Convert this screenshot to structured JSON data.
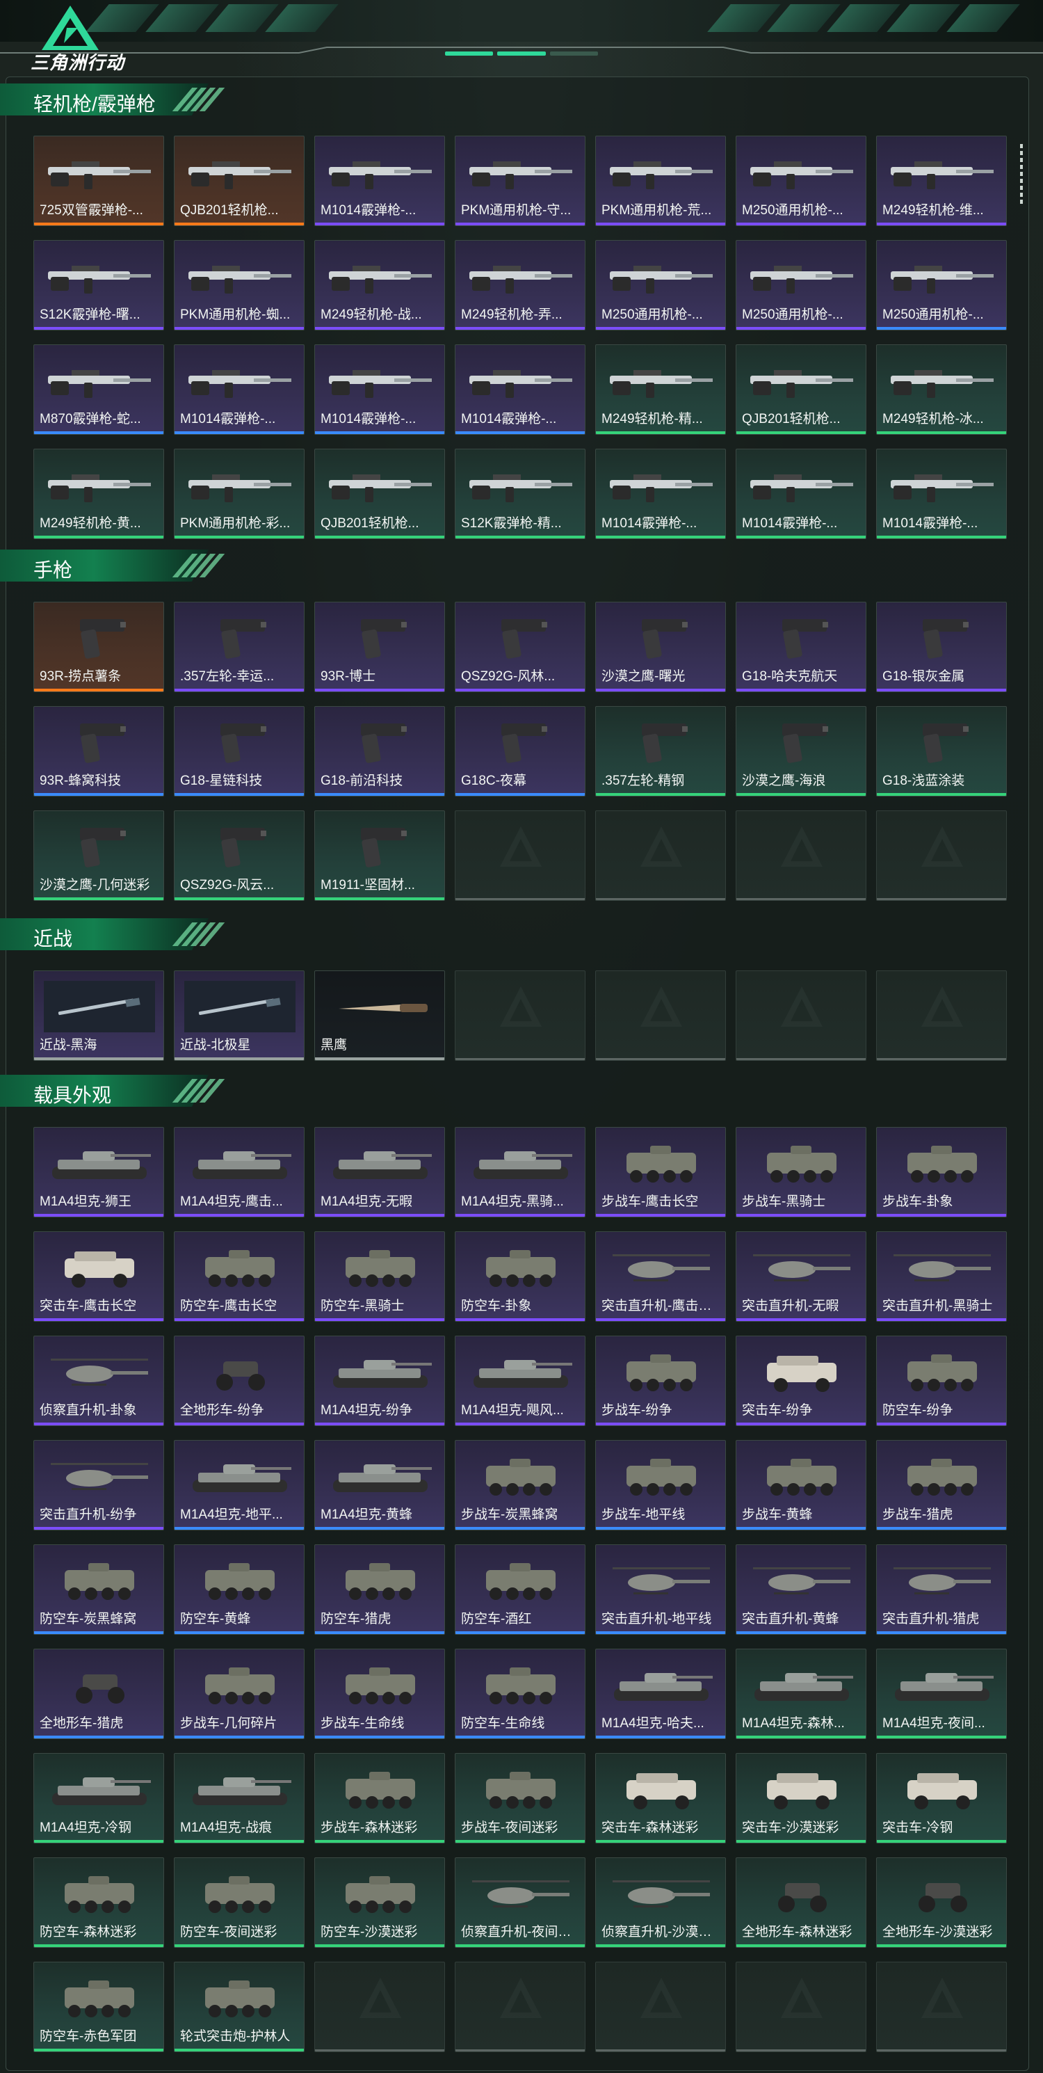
{
  "app": {
    "title": "三角洲行动"
  },
  "colors": {
    "accent": "#2fd99a",
    "purple": "#7c4dff",
    "blue": "#3a8bff",
    "green": "#35d37a",
    "orange": "#ff7a1a",
    "gray": "#9aa3a0"
  },
  "sections": [
    {
      "title": "轻机枪/霰弹枪",
      "items": [
        {
          "label": "725双管霰弹枪-...",
          "rarity": "orange",
          "kind": "gun"
        },
        {
          "label": "QJB201轻机枪...",
          "rarity": "orange",
          "kind": "gun"
        },
        {
          "label": "M1014霰弹枪-...",
          "rarity": "purple",
          "kind": "gun"
        },
        {
          "label": "PKM通用机枪-守...",
          "rarity": "purple",
          "kind": "gun"
        },
        {
          "label": "PKM通用机枪-荒...",
          "rarity": "purple",
          "kind": "gun"
        },
        {
          "label": "M250通用机枪-...",
          "rarity": "purple",
          "kind": "gun"
        },
        {
          "label": "M249轻机枪-维...",
          "rarity": "purple",
          "kind": "gun"
        },
        {
          "label": "S12K霰弹枪-曙...",
          "rarity": "purple",
          "kind": "gun"
        },
        {
          "label": "PKM通用机枪-蜘...",
          "rarity": "purple",
          "kind": "gun"
        },
        {
          "label": "M249轻机枪-战...",
          "rarity": "purple",
          "kind": "gun"
        },
        {
          "label": "M249轻机枪-弄...",
          "rarity": "purple",
          "kind": "gun"
        },
        {
          "label": "M250通用机枪-...",
          "rarity": "purple",
          "kind": "gun"
        },
        {
          "label": "M250通用机枪-...",
          "rarity": "purple",
          "kind": "gun"
        },
        {
          "label": "M250通用机枪-...",
          "rarity": "blue",
          "kind": "gun"
        },
        {
          "label": "M870霰弹枪-蛇...",
          "rarity": "blue",
          "kind": "gun"
        },
        {
          "label": "M1014霰弹枪-...",
          "rarity": "blue",
          "kind": "gun"
        },
        {
          "label": "M1014霰弹枪-...",
          "rarity": "blue",
          "kind": "gun"
        },
        {
          "label": "M1014霰弹枪-...",
          "rarity": "blue",
          "kind": "gun"
        },
        {
          "label": "M249轻机枪-精...",
          "rarity": "green",
          "kind": "gun"
        },
        {
          "label": "QJB201轻机枪...",
          "rarity": "green",
          "kind": "gun"
        },
        {
          "label": "M249轻机枪-冰...",
          "rarity": "green",
          "kind": "gun"
        },
        {
          "label": "M249轻机枪-黄...",
          "rarity": "green",
          "kind": "gun"
        },
        {
          "label": "PKM通用机枪-彩...",
          "rarity": "green",
          "kind": "gun"
        },
        {
          "label": "QJB201轻机枪...",
          "rarity": "green",
          "kind": "gun"
        },
        {
          "label": "S12K霰弹枪-精...",
          "rarity": "green",
          "kind": "gun"
        },
        {
          "label": "M1014霰弹枪-...",
          "rarity": "green",
          "kind": "gun"
        },
        {
          "label": "M1014霰弹枪-...",
          "rarity": "green",
          "kind": "gun"
        },
        {
          "label": "M1014霰弹枪-...",
          "rarity": "green",
          "kind": "gun"
        }
      ]
    },
    {
      "title": "手枪",
      "items": [
        {
          "label": "93R-捞点薯条",
          "rarity": "orange",
          "kind": "pistol"
        },
        {
          "label": ".357左轮-幸运...",
          "rarity": "purple",
          "kind": "pistol"
        },
        {
          "label": "93R-博士",
          "rarity": "purple",
          "kind": "pistol"
        },
        {
          "label": "QSZ92G-风林...",
          "rarity": "purple",
          "kind": "pistol"
        },
        {
          "label": "沙漠之鹰-曙光",
          "rarity": "purple",
          "kind": "pistol"
        },
        {
          "label": "G18-哈夫克航天",
          "rarity": "purple",
          "kind": "pistol"
        },
        {
          "label": "G18-银灰金属",
          "rarity": "purple",
          "kind": "pistol"
        },
        {
          "label": "93R-蜂窝科技",
          "rarity": "blue",
          "kind": "pistol"
        },
        {
          "label": "G18-星链科技",
          "rarity": "blue",
          "kind": "pistol"
        },
        {
          "label": "G18-前沿科技",
          "rarity": "blue",
          "kind": "pistol"
        },
        {
          "label": "G18C-夜幕",
          "rarity": "blue",
          "kind": "pistol"
        },
        {
          "label": ".357左轮-精钢",
          "rarity": "green",
          "kind": "pistol"
        },
        {
          "label": "沙漠之鹰-海浪",
          "rarity": "green",
          "kind": "pistol"
        },
        {
          "label": "G18-浅蓝涂装",
          "rarity": "green",
          "kind": "pistol"
        },
        {
          "label": "沙漠之鹰-几何迷彩",
          "rarity": "green",
          "kind": "pistol"
        },
        {
          "label": "QSZ92G-风云...",
          "rarity": "green",
          "kind": "pistol"
        },
        {
          "label": "M1911-坚固材...",
          "rarity": "green",
          "kind": "pistol"
        },
        {
          "label": "",
          "rarity": "empty",
          "kind": "empty"
        },
        {
          "label": "",
          "rarity": "empty",
          "kind": "empty"
        },
        {
          "label": "",
          "rarity": "empty",
          "kind": "empty"
        },
        {
          "label": "",
          "rarity": "empty",
          "kind": "empty"
        }
      ]
    },
    {
      "title": "近战",
      "items": [
        {
          "label": "近战-黑海",
          "rarity": "gray",
          "kind": "melee"
        },
        {
          "label": "近战-北极星",
          "rarity": "gray",
          "kind": "melee"
        },
        {
          "label": "黑鹰",
          "rarity": "dark",
          "kind": "knife"
        },
        {
          "label": "",
          "rarity": "empty",
          "kind": "empty"
        },
        {
          "label": "",
          "rarity": "empty",
          "kind": "empty"
        },
        {
          "label": "",
          "rarity": "empty",
          "kind": "empty"
        },
        {
          "label": "",
          "rarity": "empty",
          "kind": "empty"
        }
      ]
    },
    {
      "title": "载具外观",
      "items": [
        {
          "label": "M1A4坦克-狮王",
          "rarity": "purple",
          "kind": "tank"
        },
        {
          "label": "M1A4坦克-鹰击...",
          "rarity": "purple",
          "kind": "tank"
        },
        {
          "label": "M1A4坦克-无暇",
          "rarity": "purple",
          "kind": "tank"
        },
        {
          "label": "M1A4坦克-黑骑...",
          "rarity": "purple",
          "kind": "tank"
        },
        {
          "label": "步战车-鹰击长空",
          "rarity": "purple",
          "kind": "apc"
        },
        {
          "label": "步战车-黑骑士",
          "rarity": "purple",
          "kind": "apc"
        },
        {
          "label": "步战车-卦象",
          "rarity": "purple",
          "kind": "apc"
        },
        {
          "label": "突击车-鹰击长空",
          "rarity": "purple",
          "kind": "jeep"
        },
        {
          "label": "防空车-鹰击长空",
          "rarity": "purple",
          "kind": "apc"
        },
        {
          "label": "防空车-黑骑士",
          "rarity": "purple",
          "kind": "apc"
        },
        {
          "label": "防空车-卦象",
          "rarity": "purple",
          "kind": "apc"
        },
        {
          "label": "突击直升机-鹰击长...",
          "rarity": "purple",
          "kind": "heli"
        },
        {
          "label": "突击直升机-无暇",
          "rarity": "purple",
          "kind": "heli"
        },
        {
          "label": "突击直升机-黑骑士",
          "rarity": "purple",
          "kind": "heli"
        },
        {
          "label": "侦察直升机-卦象",
          "rarity": "purple",
          "kind": "heli"
        },
        {
          "label": "全地形车-纷争",
          "rarity": "purple",
          "kind": "atv"
        },
        {
          "label": "M1A4坦克-纷争",
          "rarity": "purple",
          "kind": "tank"
        },
        {
          "label": "M1A4坦克-飓风...",
          "rarity": "purple",
          "kind": "tank"
        },
        {
          "label": "步战车-纷争",
          "rarity": "purple",
          "kind": "apc"
        },
        {
          "label": "突击车-纷争",
          "rarity": "purple",
          "kind": "jeep"
        },
        {
          "label": "防空车-纷争",
          "rarity": "purple",
          "kind": "apc"
        },
        {
          "label": "突击直升机-纷争",
          "rarity": "purple",
          "kind": "heli"
        },
        {
          "label": "M1A4坦克-地平...",
          "rarity": "blue",
          "kind": "tank"
        },
        {
          "label": "M1A4坦克-黄蜂",
          "rarity": "blue",
          "kind": "tank"
        },
        {
          "label": "步战车-炭黑蜂窝",
          "rarity": "blue",
          "kind": "apc"
        },
        {
          "label": "步战车-地平线",
          "rarity": "blue",
          "kind": "apc"
        },
        {
          "label": "步战车-黄蜂",
          "rarity": "blue",
          "kind": "apc"
        },
        {
          "label": "步战车-猎虎",
          "rarity": "blue",
          "kind": "apc"
        },
        {
          "label": "防空车-炭黑蜂窝",
          "rarity": "blue",
          "kind": "apc"
        },
        {
          "label": "防空车-黄蜂",
          "rarity": "blue",
          "kind": "apc"
        },
        {
          "label": "防空车-猎虎",
          "rarity": "blue",
          "kind": "apc"
        },
        {
          "label": "防空车-酒红",
          "rarity": "blue",
          "kind": "apc"
        },
        {
          "label": "突击直升机-地平线",
          "rarity": "blue",
          "kind": "heli"
        },
        {
          "label": "突击直升机-黄蜂",
          "rarity": "blue",
          "kind": "heli"
        },
        {
          "label": "突击直升机-猎虎",
          "rarity": "blue",
          "kind": "heli"
        },
        {
          "label": "全地形车-猎虎",
          "rarity": "blue",
          "kind": "atv"
        },
        {
          "label": "步战车-几何碎片",
          "rarity": "blue",
          "kind": "apc"
        },
        {
          "label": "步战车-生命线",
          "rarity": "blue",
          "kind": "apc"
        },
        {
          "label": "防空车-生命线",
          "rarity": "blue",
          "kind": "apc"
        },
        {
          "label": "M1A4坦克-哈夫...",
          "rarity": "blue",
          "kind": "tank"
        },
        {
          "label": "M1A4坦克-森林...",
          "rarity": "green",
          "kind": "tank"
        },
        {
          "label": "M1A4坦克-夜间...",
          "rarity": "green",
          "kind": "tank"
        },
        {
          "label": "M1A4坦克-冷钢",
          "rarity": "green",
          "kind": "tank"
        },
        {
          "label": "M1A4坦克-战痕",
          "rarity": "green",
          "kind": "tank"
        },
        {
          "label": "步战车-森林迷彩",
          "rarity": "green",
          "kind": "apc"
        },
        {
          "label": "步战车-夜间迷彩",
          "rarity": "green",
          "kind": "apc"
        },
        {
          "label": "突击车-森林迷彩",
          "rarity": "green",
          "kind": "jeep"
        },
        {
          "label": "突击车-沙漠迷彩",
          "rarity": "green",
          "kind": "jeep"
        },
        {
          "label": "突击车-冷钢",
          "rarity": "green",
          "kind": "jeep"
        },
        {
          "label": "防空车-森林迷彩",
          "rarity": "green",
          "kind": "apc"
        },
        {
          "label": "防空车-夜间迷彩",
          "rarity": "green",
          "kind": "apc"
        },
        {
          "label": "防空车-沙漠迷彩",
          "rarity": "green",
          "kind": "apc"
        },
        {
          "label": "侦察直升机-夜间迷...",
          "rarity": "green",
          "kind": "heli"
        },
        {
          "label": "侦察直升机-沙漠迷...",
          "rarity": "green",
          "kind": "heli"
        },
        {
          "label": "全地形车-森林迷彩",
          "rarity": "green",
          "kind": "atv"
        },
        {
          "label": "全地形车-沙漠迷彩",
          "rarity": "green",
          "kind": "atv"
        },
        {
          "label": "防空车-赤色军团",
          "rarity": "green",
          "kind": "apc"
        },
        {
          "label": "轮式突击炮-护林人",
          "rarity": "green",
          "kind": "apc"
        },
        {
          "label": "",
          "rarity": "empty",
          "kind": "empty"
        },
        {
          "label": "",
          "rarity": "empty",
          "kind": "empty"
        },
        {
          "label": "",
          "rarity": "empty",
          "kind": "empty"
        },
        {
          "label": "",
          "rarity": "empty",
          "kind": "empty"
        },
        {
          "label": "",
          "rarity": "empty",
          "kind": "empty"
        }
      ]
    }
  ]
}
